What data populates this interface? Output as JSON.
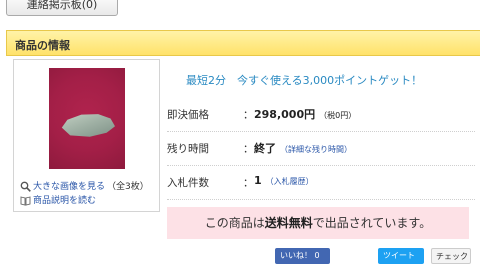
{
  "top_button": {
    "label": "連絡掲示板(0)"
  },
  "section": {
    "title": "商品の情報"
  },
  "image_panel": {
    "large_image_link": "大きな画像を見る",
    "image_count": "（全3枚）",
    "description_link": "商品説明を読む"
  },
  "promo": {
    "text": "最短2分　今すぐ使える3,000ポイントゲット！"
  },
  "details": {
    "buy_now": {
      "label": "即決価格",
      "value": "298,000円",
      "note": "（税0円）"
    },
    "time_left": {
      "label": "残り時間",
      "value": "終了",
      "link": "（詳細な残り時間）"
    },
    "bids": {
      "label": "入札件数",
      "value": "1",
      "link": "（入札履歴）"
    },
    "separator": "："
  },
  "shipping": {
    "prefix": "この商品は",
    "bold": "送料無料",
    "suffix": "で出品されています。"
  },
  "social": {
    "like": "いいね！ 0",
    "tweet": "ツイート",
    "check": "チェック"
  },
  "colors": {
    "header_bg": "#ffe26a",
    "link": "#2a56a8",
    "promo": "#2a8ac2",
    "shipping_bg": "#fde1e6"
  }
}
